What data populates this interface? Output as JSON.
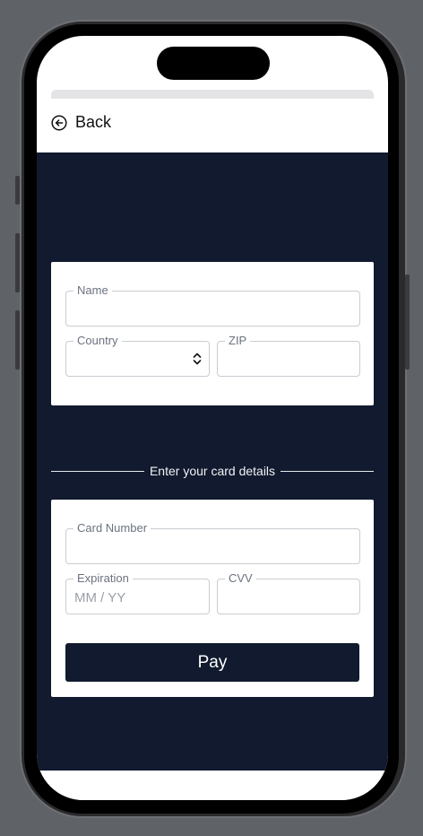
{
  "header": {
    "back_label": "Back",
    "back_icon": "arrow-left-circle-icon"
  },
  "billing": {
    "name_label": "Name",
    "name_value": "",
    "country_label": "Country",
    "country_value": "",
    "zip_label": "ZIP",
    "zip_value": ""
  },
  "divider": {
    "text": "Enter your card details"
  },
  "card_details": {
    "card_number_label": "Card Number",
    "card_number_value": "",
    "expiration_label": "Expiration",
    "expiration_placeholder": "MM / YY",
    "cvv_label": "CVV",
    "cvv_value": ""
  },
  "pay_button": {
    "label": "Pay"
  },
  "colors": {
    "background_dark": "#111a2e",
    "frame": "#5f6368"
  }
}
